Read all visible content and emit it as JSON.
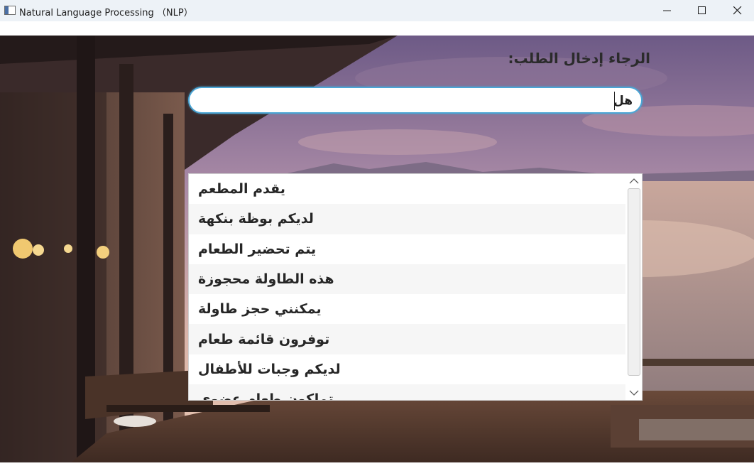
{
  "window": {
    "title": "Natural Language Processing （NLP）",
    "controls": {
      "minimize_icon": "minimize-icon",
      "maximize_icon": "maximize-icon",
      "close_icon": "close-icon"
    }
  },
  "form": {
    "prompt_label": "الرجاء إدخال الطلب:",
    "query_value": "هل",
    "accent_color": "#4aa6d6"
  },
  "suggestions": {
    "items": [
      "يقدم المطعم",
      "لديكم بوظة بنكهة",
      "يتم تحضير الطعام",
      "هذه الطاولة محجوزة",
      "يمكنني حجز طاولة",
      "توفرون قائمة طعام",
      "لديكم وجبات للأطفال",
      "تملكون طعام عضوي"
    ],
    "scroll_up_icon": "chevron-up-icon",
    "scroll_down_icon": "chevron-down-icon"
  },
  "background": {
    "description_icon": "restaurant-terrace-sunset-image"
  }
}
